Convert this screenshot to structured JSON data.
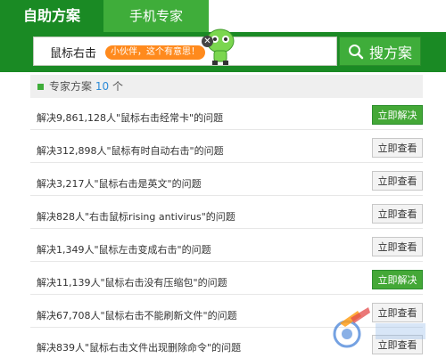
{
  "tabs": [
    {
      "label": "自助方案",
      "active": true
    },
    {
      "label": "手机专家",
      "active": false
    }
  ],
  "search": {
    "query": "鼠标右击",
    "tip_badge": "小伙伴，这个有意思！",
    "button_label": "搜方案"
  },
  "results_header": {
    "label": "专家方案",
    "count": "10",
    "unit": "个"
  },
  "rows": [
    {
      "text": "解决9,861,128人\"鼠标右击经常卡\"的问题",
      "button": "立即解决",
      "style": "solve"
    },
    {
      "text": "解决312,898人\"鼠标有时自动右击\"的问题",
      "button": "立即查看",
      "style": "view"
    },
    {
      "text": "解决3,217人\"鼠标右击是英文\"的问题",
      "button": "立即查看",
      "style": "view"
    },
    {
      "text": "解决828人\"右击鼠标rising antivirus\"的问题",
      "button": "立即查看",
      "style": "view"
    },
    {
      "text": "解决1,349人\"鼠标左击变成右击\"的问题",
      "button": "立即查看",
      "style": "view"
    },
    {
      "text": "解决11,139人\"鼠标右击没有压缩包\"的问题",
      "button": "立即解决",
      "style": "solve"
    },
    {
      "text": "解决67,708人\"鼠标右击不能刷新文件\"的问题",
      "button": "立即查看",
      "style": "view"
    },
    {
      "text": "解决839人\"鼠标右击文件出现删除命令\"的问题",
      "button": "立即查看",
      "style": "view"
    }
  ],
  "colors": {
    "brand_green": "#1a8a24",
    "accent_green": "#3fad3a",
    "badge_orange": "#ff8a1d",
    "count_blue": "#2c8bd8"
  },
  "icons": {
    "search": "magnifier-icon",
    "close": "close-icon",
    "mascot": "mascot-icon",
    "bullet": "square-bullet-icon"
  }
}
